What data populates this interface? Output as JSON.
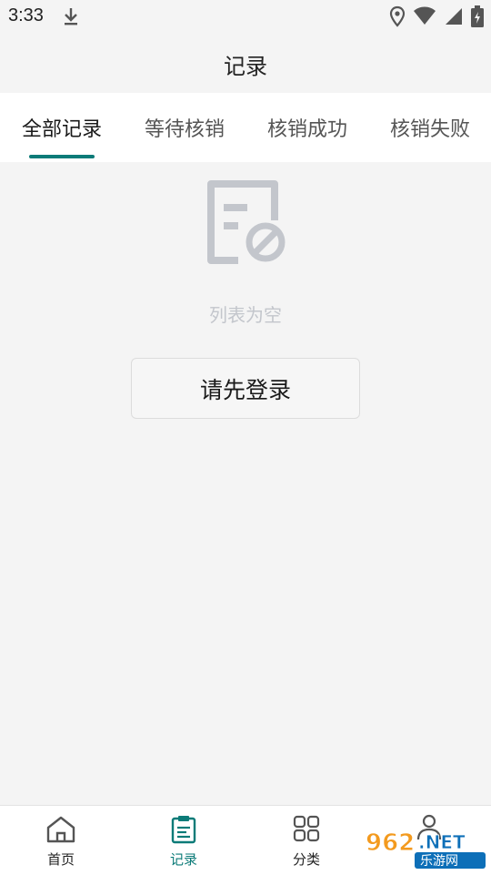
{
  "statusbar": {
    "time": "3:33"
  },
  "header": {
    "title": "记录"
  },
  "tabs": [
    {
      "label": "全部记录",
      "active": true
    },
    {
      "label": "等待核销",
      "active": false
    },
    {
      "label": "核销成功",
      "active": false
    },
    {
      "label": "核销失败",
      "active": false
    }
  ],
  "empty": {
    "text": "列表为空",
    "login_label": "请先登录"
  },
  "bottom_nav": [
    {
      "label": "首页",
      "icon": "home-icon"
    },
    {
      "label": "记录",
      "icon": "clipboard-icon",
      "active": true
    },
    {
      "label": "分类",
      "icon": "grid-icon"
    },
    {
      "label": "",
      "icon": "user-icon"
    }
  ],
  "watermark": {
    "text": "962.NET",
    "sub": "乐游网"
  },
  "colors": {
    "accent": "#0c7b78",
    "muted": "#c3c6cc"
  }
}
